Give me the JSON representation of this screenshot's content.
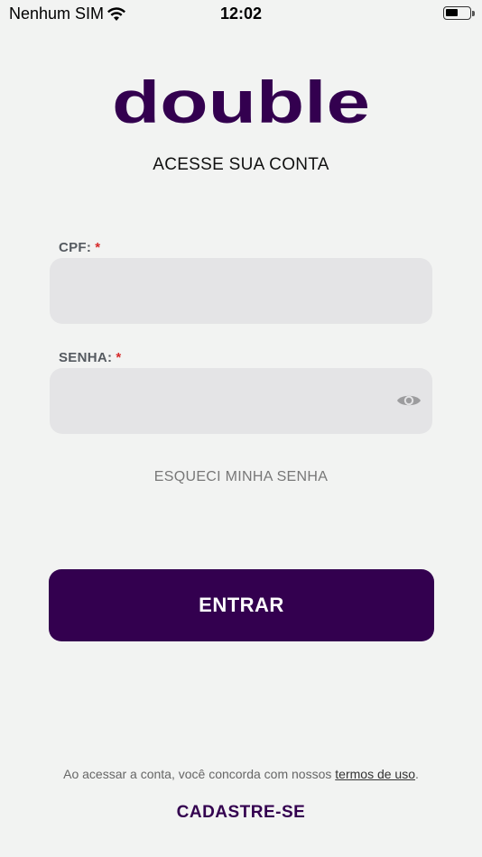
{
  "status_bar": {
    "carrier": "Nenhum SIM",
    "time": "12:02",
    "wifi_icon": "wifi-icon",
    "battery_icon": "battery-icon"
  },
  "brand": {
    "logo_text": "double",
    "color": "#33004f"
  },
  "header": {
    "subtitle": "ACESSE SUA CONTA"
  },
  "form": {
    "cpf": {
      "label": "CPF:",
      "required_mark": "*",
      "value": ""
    },
    "password": {
      "label": "SENHA:",
      "required_mark": "*",
      "value": "",
      "toggle_icon": "eye-icon"
    },
    "forgot_label": "ESQUECI MINHA SENHA",
    "submit_label": "ENTRAR"
  },
  "footer": {
    "terms_prefix": "Ao acessar a conta, você concorda com nossos",
    "terms_link": "termos de uso",
    "terms_suffix": ".",
    "signup_label": "CADASTRE-SE"
  },
  "colors": {
    "background": "#f2f3f2",
    "input_bg": "#e4e4e6",
    "primary": "#33004f",
    "required": "#d62a2a"
  }
}
